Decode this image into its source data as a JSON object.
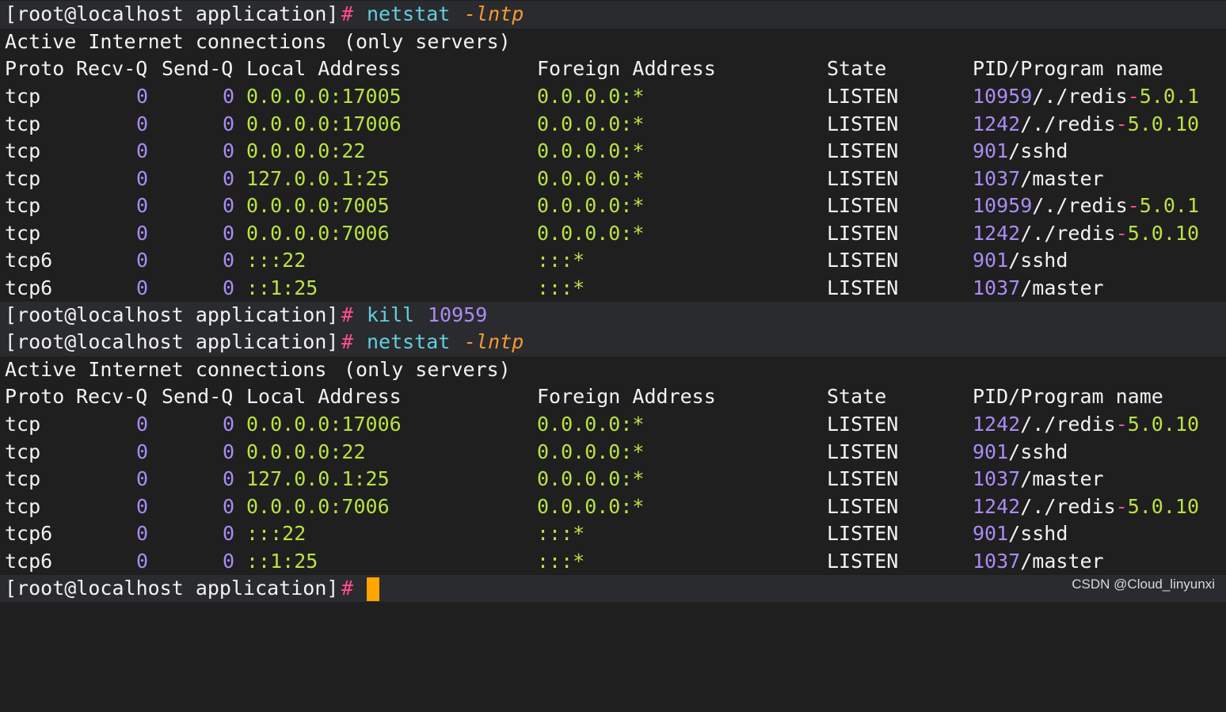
{
  "prompt": {
    "user_host": "[root@localhost application]",
    "symbol": "#"
  },
  "commands": [
    {
      "cmd": "netstat",
      "arg": "-lntp"
    },
    {
      "cmd": "kill",
      "arg": "10959"
    },
    {
      "cmd": "netstat",
      "arg": "-lntp"
    }
  ],
  "output_header": {
    "title_a": "Active Internet connections ",
    "title_b": "(only servers)",
    "proto": "Proto",
    "recv_q": "Recv-Q",
    "send_q": "Send-Q",
    "local": "Local Address",
    "foreign": "Foreign Address",
    "state": "State",
    "pid_program": "PID/Program name"
  },
  "table1": [
    {
      "proto": "tcp",
      "recv": "0",
      "send": "0",
      "local": "0.0.0.0:17005",
      "foreign": "0.0.0.0:*",
      "state": "LISTEN",
      "pid": "10959",
      "prog": "/./redis-5.0.1"
    },
    {
      "proto": "tcp",
      "recv": "0",
      "send": "0",
      "local": "0.0.0.0:17006",
      "foreign": "0.0.0.0:*",
      "state": "LISTEN",
      "pid": "1242",
      "prog": "/./redis-5.0.10"
    },
    {
      "proto": "tcp",
      "recv": "0",
      "send": "0",
      "local": "0.0.0.0:22",
      "foreign": "0.0.0.0:*",
      "state": "LISTEN",
      "pid": "901",
      "prog": "/sshd"
    },
    {
      "proto": "tcp",
      "recv": "0",
      "send": "0",
      "local": "127.0.0.1:25",
      "foreign": "0.0.0.0:*",
      "state": "LISTEN",
      "pid": "1037",
      "prog": "/master"
    },
    {
      "proto": "tcp",
      "recv": "0",
      "send": "0",
      "local": "0.0.0.0:7005",
      "foreign": "0.0.0.0:*",
      "state": "LISTEN",
      "pid": "10959",
      "prog": "/./redis-5.0.1"
    },
    {
      "proto": "tcp",
      "recv": "0",
      "send": "0",
      "local": "0.0.0.0:7006",
      "foreign": "0.0.0.0:*",
      "state": "LISTEN",
      "pid": "1242",
      "prog": "/./redis-5.0.10"
    },
    {
      "proto": "tcp6",
      "recv": "0",
      "send": "0",
      "local": ":::22",
      "foreign": ":::*",
      "state": "LISTEN",
      "pid": "901",
      "prog": "/sshd"
    },
    {
      "proto": "tcp6",
      "recv": "0",
      "send": "0",
      "local": "::1:25",
      "foreign": ":::*",
      "state": "LISTEN",
      "pid": "1037",
      "prog": "/master"
    }
  ],
  "table2": [
    {
      "proto": "tcp",
      "recv": "0",
      "send": "0",
      "local": "0.0.0.0:17006",
      "foreign": "0.0.0.0:*",
      "state": "LISTEN",
      "pid": "1242",
      "prog": "/./redis-5.0.10"
    },
    {
      "proto": "tcp",
      "recv": "0",
      "send": "0",
      "local": "0.0.0.0:22",
      "foreign": "0.0.0.0:*",
      "state": "LISTEN",
      "pid": "901",
      "prog": "/sshd"
    },
    {
      "proto": "tcp",
      "recv": "0",
      "send": "0",
      "local": "127.0.0.1:25",
      "foreign": "0.0.0.0:*",
      "state": "LISTEN",
      "pid": "1037",
      "prog": "/master"
    },
    {
      "proto": "tcp",
      "recv": "0",
      "send": "0",
      "local": "0.0.0.0:7006",
      "foreign": "0.0.0.0:*",
      "state": "LISTEN",
      "pid": "1242",
      "prog": "/./redis-5.0.10"
    },
    {
      "proto": "tcp6",
      "recv": "0",
      "send": "0",
      "local": ":::22",
      "foreign": ":::*",
      "state": "LISTEN",
      "pid": "901",
      "prog": "/sshd"
    },
    {
      "proto": "tcp6",
      "recv": "0",
      "send": "0",
      "local": "::1:25",
      "foreign": ":::*",
      "state": "LISTEN",
      "pid": "1037",
      "prog": "/master"
    }
  ],
  "watermark": "CSDN @Cloud_linyunxi",
  "colors": {
    "background": "#1f1f1f",
    "prompt_band": "#2a2b2e",
    "number": "#a98cf5",
    "address": "#b9e342",
    "command": "#62cfe0",
    "option": "#f59a33",
    "prompt_symbol": "#ff4f86",
    "cursor": "#ffa500"
  }
}
